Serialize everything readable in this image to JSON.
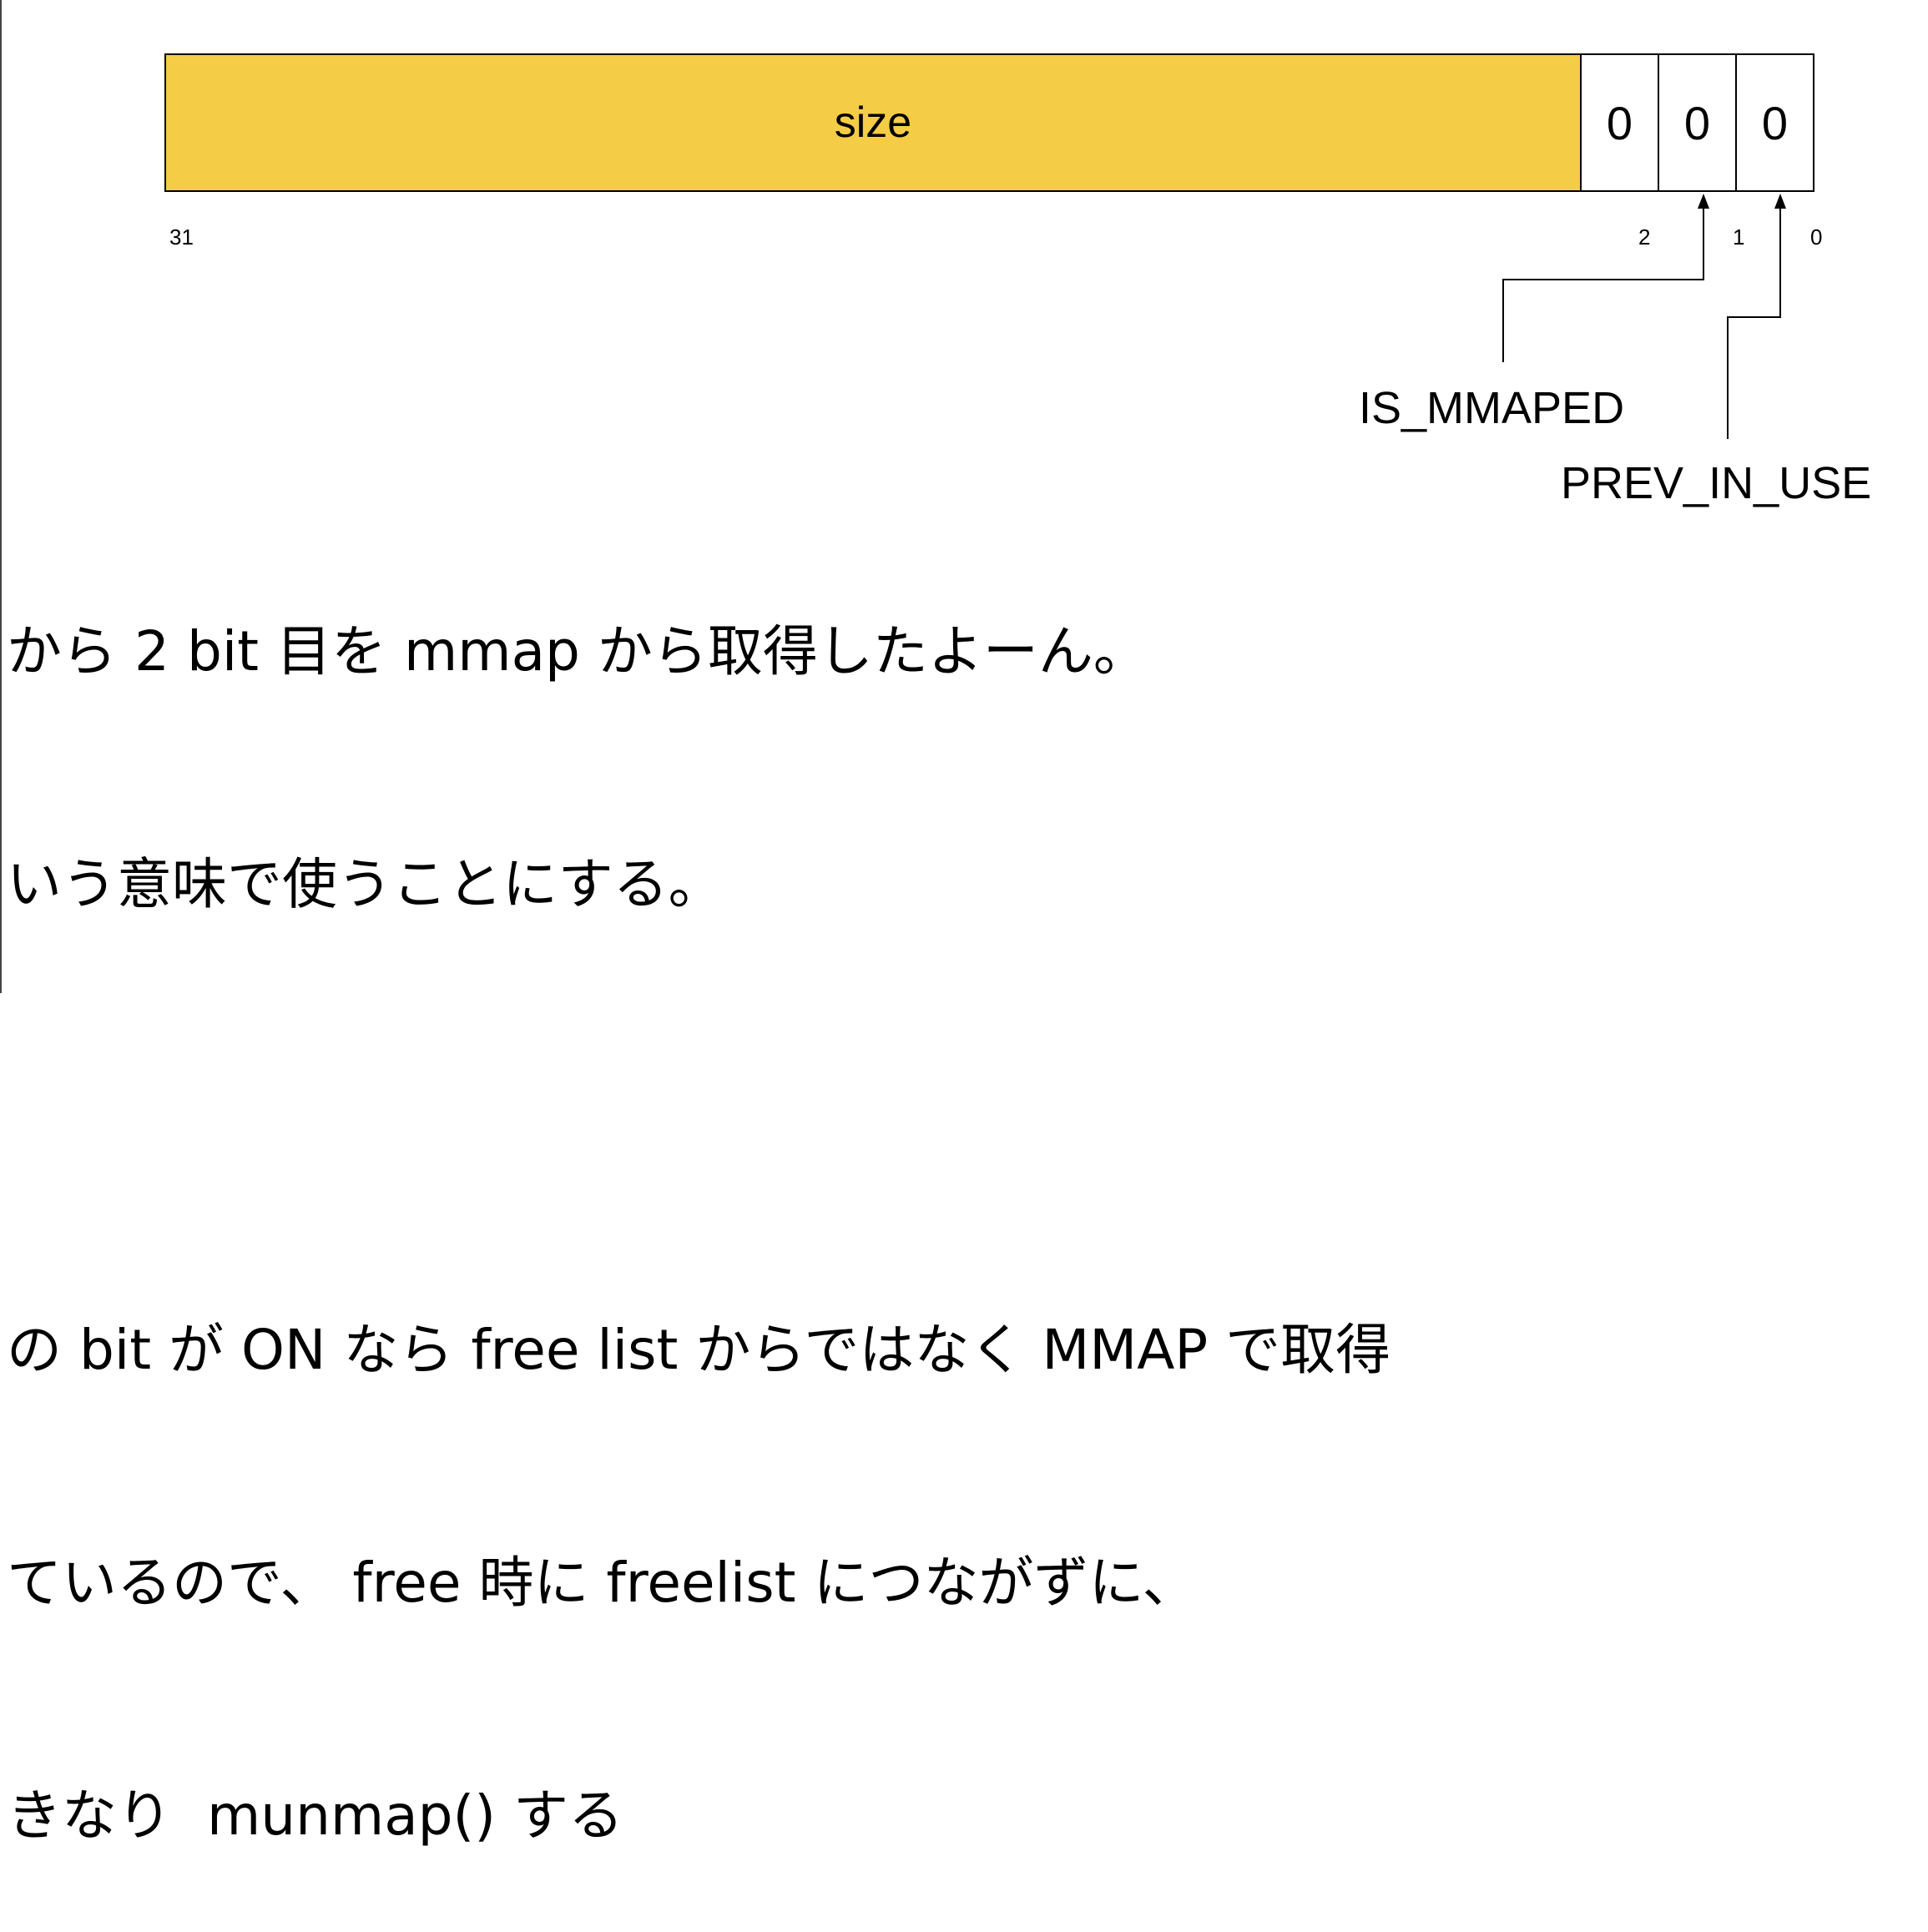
{
  "diagram": {
    "size_field": {
      "label": "size",
      "fill_color": "#F5CC46"
    },
    "flag_bits": [
      "0",
      "0",
      "0"
    ],
    "bit_indices": {
      "msb": "31",
      "b2": "2",
      "b1": "1",
      "b0": "0"
    },
    "flags": {
      "is_mmaped": "IS_MMAPED",
      "prev_in_use": "PREV_IN_USE"
    }
  },
  "notes": [
    "から 2 bit 目を mmap から取得したよーん。",
    "いう意味で使うことにする。",
    "",
    "の bit が ON なら free list からではなく MMAP で取得",
    "ているので、 free 時に freelist につながずに、",
    "きなり  munmap() する"
  ]
}
